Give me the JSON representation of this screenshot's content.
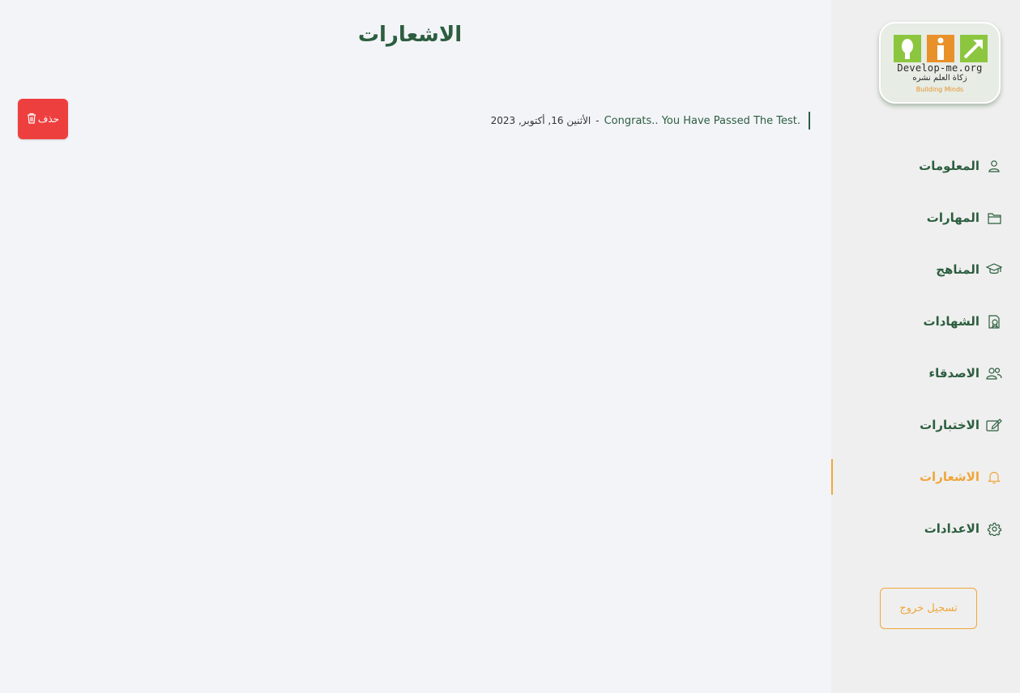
{
  "brand": {
    "domain": "Develop-me.org",
    "arabic_tagline": "زكاة العلم نشره",
    "tagline": "Building Minds",
    "colors": {
      "green": "#8cc63f",
      "orange": "#e8912a"
    }
  },
  "sidebar": {
    "items": [
      {
        "label": "المعلومات",
        "icon": "user-icon",
        "active": false
      },
      {
        "label": "المهارات",
        "icon": "folder-icon",
        "active": false
      },
      {
        "label": "المناهج",
        "icon": "graduation-cap-icon",
        "active": false
      },
      {
        "label": "الشهادات",
        "icon": "certificate-icon",
        "active": false
      },
      {
        "label": "الاصدقاء",
        "icon": "users-icon",
        "active": false
      },
      {
        "label": "الاختبارات",
        "icon": "edit-icon",
        "active": false
      },
      {
        "label": "الاشعارات",
        "icon": "bell-icon",
        "active": true
      },
      {
        "label": "الاعدادات",
        "icon": "gear-icon",
        "active": false
      }
    ],
    "logout_label": "تسجيل خروج"
  },
  "main": {
    "title": "الاشعارات",
    "notifications": [
      {
        "message": "Congrats.. You Have Passed The Test.",
        "separator": "-",
        "date": "الأثنين 16, أكتوبر, 2023"
      }
    ],
    "delete_label": "حذف"
  },
  "colors": {
    "primary_green": "#2c5e3f",
    "accent_orange": "#f0a63a",
    "danger_red": "#ee3f3f",
    "page_bg": "#f3f4f8",
    "sidebar_bg": "#efefef"
  }
}
